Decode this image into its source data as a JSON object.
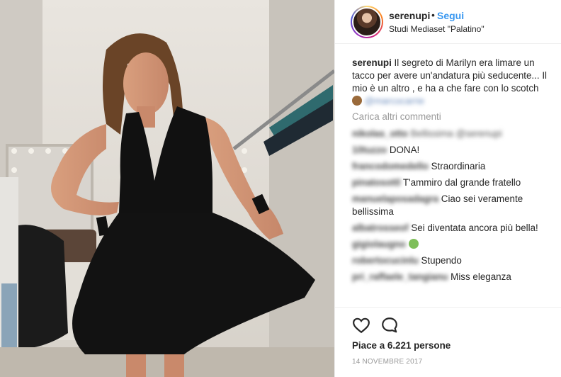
{
  "post": {
    "username": "serenupi",
    "separator": "•",
    "follow_label": "Segui",
    "location": "Studi Mediaset \"Palatino\""
  },
  "caption": {
    "username": "serenupi",
    "text": "Il segreto di Marilyn era limare un tacco per avere un'andatura più seducente... Il mio è un altro , e ha a che fare con lo scotch",
    "mention": "@marcocarrie"
  },
  "load_more_label": "Carica altri commenti",
  "comments": [
    {
      "user": "nikolas_otto",
      "text": "Bellissima @serenupi",
      "blur_text": true
    },
    {
      "user": "10tuzzo",
      "text": "DONA!"
    },
    {
      "user": "francodomedello",
      "text": "Straordinaria"
    },
    {
      "user": "pinatosottl",
      "text": "T'ammiro dal grande fratello"
    },
    {
      "user": "manuelaposadagra",
      "text": "Ciao sei veramente bellissima"
    },
    {
      "user": "albatrosseof",
      "text": "Sei diventata ancora più bella!"
    },
    {
      "user": "gigiolaugno",
      "text": ""
    },
    {
      "user": "robertocucinlu",
      "text": "Stupendo"
    },
    {
      "user": "pri_raffaele_tangianu",
      "text": "Miss eleganza"
    }
  ],
  "likes_text": "Piace a 6.221 persone",
  "date_text": "14 NOVEMBRE 2017",
  "icons": {
    "like": "heart-icon",
    "comment": "speech-bubble-icon",
    "caption_emoji": "monkey-emoji-icon",
    "comment_emoji": "sick-face-emoji-icon"
  },
  "colors": {
    "follow": "#3897f0",
    "text": "#262626",
    "muted": "#999999",
    "divider": "#efefef"
  }
}
